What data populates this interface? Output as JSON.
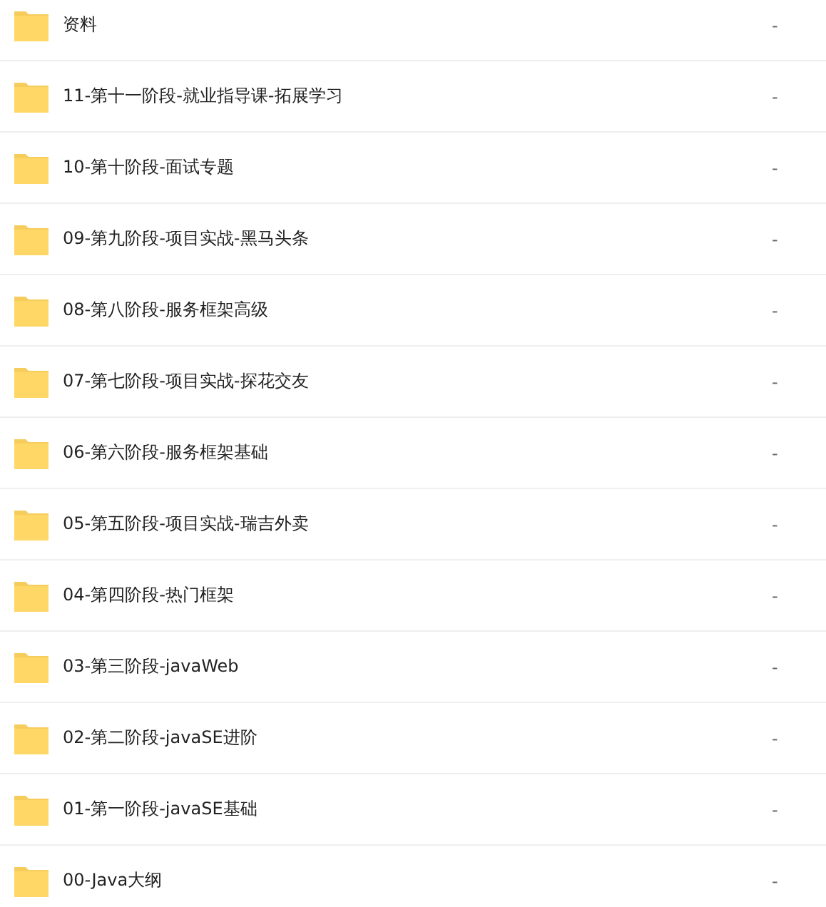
{
  "files": [
    {
      "name": "资料",
      "size": "-"
    },
    {
      "name": "11-第十一阶段-就业指导课-拓展学习",
      "size": "-"
    },
    {
      "name": "10-第十阶段-面试专题",
      "size": "-"
    },
    {
      "name": "09-第九阶段-项目实战-黑马头条",
      "size": "-"
    },
    {
      "name": "08-第八阶段-服务框架高级",
      "size": "-"
    },
    {
      "name": "07-第七阶段-项目实战-探花交友",
      "size": "-"
    },
    {
      "name": "06-第六阶段-服务框架基础",
      "size": "-"
    },
    {
      "name": "05-第五阶段-项目实战-瑞吉外卖",
      "size": "-"
    },
    {
      "name": "04-第四阶段-热门框架",
      "size": "-"
    },
    {
      "name": "03-第三阶段-javaWeb",
      "size": "-"
    },
    {
      "name": "02-第二阶段-javaSE进阶",
      "size": "-"
    },
    {
      "name": "01-第一阶段-javaSE基础",
      "size": "-"
    },
    {
      "name": "00-Java大纲",
      "size": "-"
    }
  ]
}
